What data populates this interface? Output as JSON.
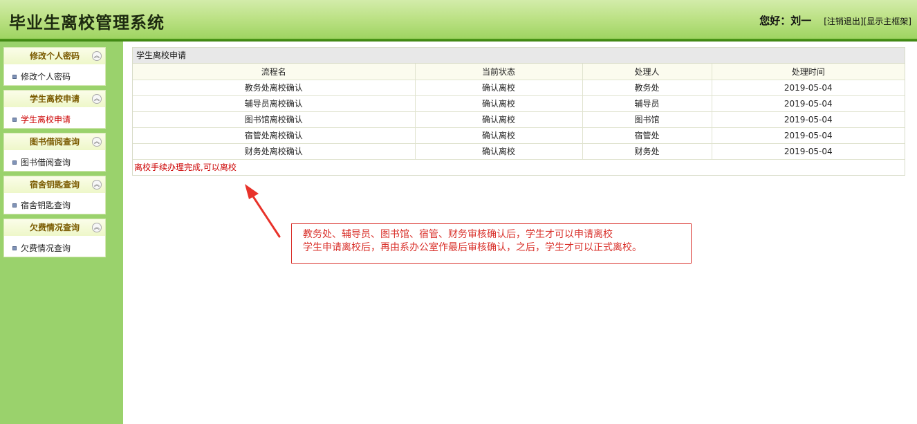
{
  "header": {
    "title": "毕业生离校管理系统",
    "greeting": "您好：刘一",
    "logout": "[注销退出]",
    "show_frame": "[显示主框架]"
  },
  "sidebar": {
    "groups": [
      {
        "title": "修改个人密码",
        "item": "修改个人密码",
        "active": false
      },
      {
        "title": "学生离校申请",
        "item": "学生离校申请",
        "active": true
      },
      {
        "title": "图书借阅查询",
        "item": "图书借阅查询",
        "active": false
      },
      {
        "title": "宿舍钥匙查询",
        "item": "宿舍钥匙查询",
        "active": false
      },
      {
        "title": "欠费情况查询",
        "item": "欠费情况查询",
        "active": false
      }
    ],
    "collapse_glyph": "︽"
  },
  "panel": {
    "title": "学生离校申请",
    "columns": [
      "流程名",
      "当前状态",
      "处理人",
      "处理时间"
    ],
    "rows": [
      [
        "教务处离校确认",
        "确认离校",
        "教务处",
        "2019-05-04"
      ],
      [
        "辅导员离校确认",
        "确认离校",
        "辅导员",
        "2019-05-04"
      ],
      [
        "图书馆离校确认",
        "确认离校",
        "图书馆",
        "2019-05-04"
      ],
      [
        "宿管处离校确认",
        "确认离校",
        "宿管处",
        "2019-05-04"
      ],
      [
        "财务处离校确认",
        "确认离校",
        "财务处",
        "2019-05-04"
      ]
    ],
    "status_message": "离校手续办理完成,可以离校"
  },
  "annotation": {
    "line1": "教务处、辅导员、图书馆、宿管、财务审核确认后，学生才可以申请离校",
    "line2": "学生申请离校后，再由系办公室作最后审核确认，之后，学生才可以正式离校。"
  },
  "colors": {
    "accent_green": "#9ad26c",
    "header_line": "#3a7f0e",
    "annotation_red": "#d9302a",
    "status_red": "#cc0000"
  }
}
